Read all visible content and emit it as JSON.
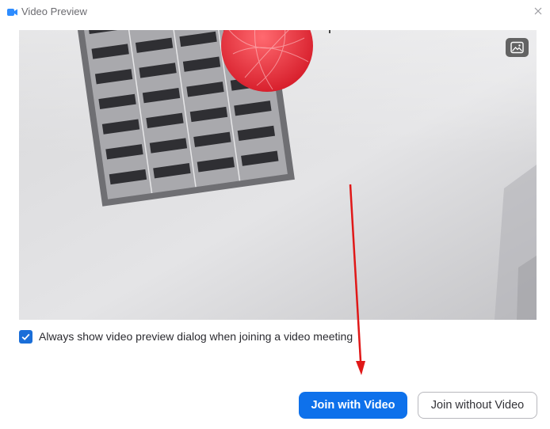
{
  "window": {
    "title": "Video Preview",
    "app_icon": "zoom-camera-icon",
    "close_icon": "close-icon"
  },
  "preview": {
    "background_toggle_icon": "image-background-icon"
  },
  "options": {
    "always_show_preview_label": "Always show video preview dialog when joining a video meeting",
    "always_show_preview_checked": true
  },
  "actions": {
    "join_with_video_label": "Join with Video",
    "join_without_video_label": "Join without Video"
  },
  "colors": {
    "accent": "#0e71eb",
    "checkbox": "#1a6ed8",
    "annotation_arrow": "#e01818"
  }
}
